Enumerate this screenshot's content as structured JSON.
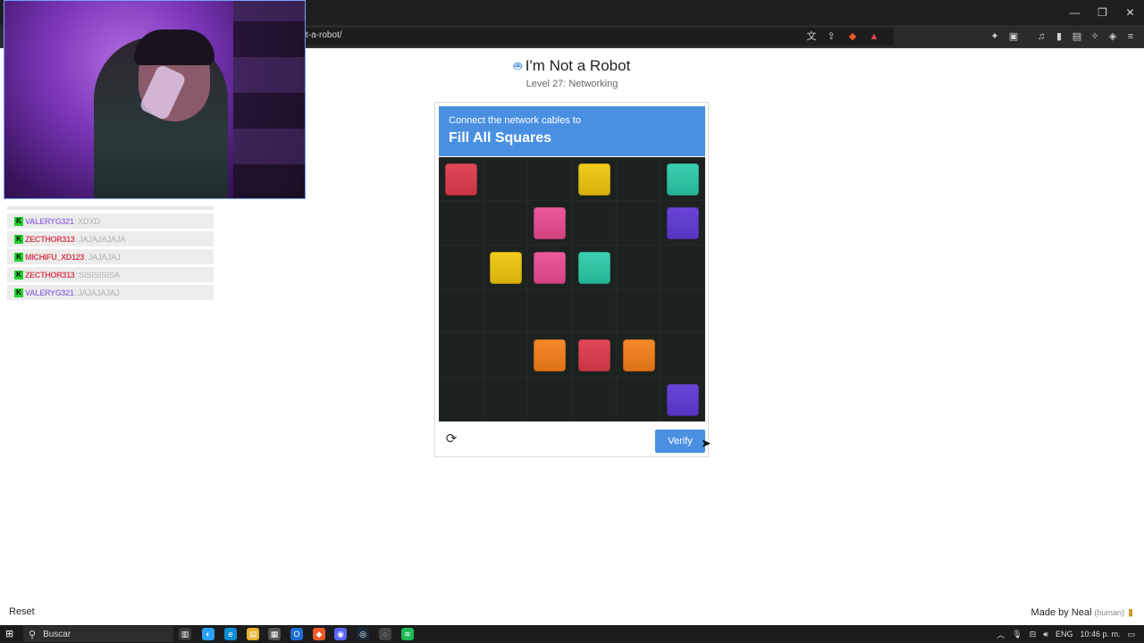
{
  "browser": {
    "url": "t-a-robot/",
    "window_controls": [
      "—",
      "❐",
      "✕"
    ],
    "icons": [
      "translate-icon",
      "share-icon",
      "brave-shield-icon",
      "rewards-icon",
      "extensions-icon",
      "screenshot-icon",
      "media-icon",
      "sidebar-icon",
      "wallet-icon",
      "leo-icon",
      "vpn-icon",
      "menu-icon"
    ]
  },
  "chat": {
    "messages": [
      {
        "user": "VALERYG321",
        "text": "XDXD",
        "color": "#9b7be0"
      },
      {
        "user": "ZECTHOR313",
        "text": "JAJAJAJAJA",
        "color": "#d9445a"
      },
      {
        "user": "MICHIFU_XD123",
        "text": "JAJAJAJ",
        "color": "#d9445a"
      },
      {
        "user": "ZECTHOR313",
        "text": "SISISISISA",
        "color": "#d9445a"
      },
      {
        "user": "VALERYG321",
        "text": "JAJAJAJAJ",
        "color": "#9b7be0"
      }
    ]
  },
  "page": {
    "title": "I'm Not a Robot",
    "subtitle": "Level 27: Networking",
    "card": {
      "instruction": "Connect the network cables to",
      "headline": "Fill All Squares",
      "verify_label": "Verify"
    },
    "grid": {
      "rows": 6,
      "cols": 6,
      "squares": [
        {
          "row": 1,
          "col": 1,
          "color": "red"
        },
        {
          "row": 1,
          "col": 4,
          "color": "yellow"
        },
        {
          "row": 1,
          "col": 6,
          "color": "teal"
        },
        {
          "row": 2,
          "col": 3,
          "color": "pink"
        },
        {
          "row": 2,
          "col": 6,
          "color": "purple"
        },
        {
          "row": 3,
          "col": 2,
          "color": "yellow"
        },
        {
          "row": 3,
          "col": 3,
          "color": "pink"
        },
        {
          "row": 3,
          "col": 4,
          "color": "teal"
        },
        {
          "row": 5,
          "col": 3,
          "color": "orange"
        },
        {
          "row": 5,
          "col": 4,
          "color": "red"
        },
        {
          "row": 5,
          "col": 5,
          "color": "orange"
        },
        {
          "row": 6,
          "col": 6,
          "color": "purple"
        }
      ]
    },
    "reset_label": "Reset",
    "made_by": "Made by Neal",
    "made_by_note": "(human)"
  },
  "taskbar": {
    "search_placeholder": "Buscar",
    "language": "ENG",
    "time": "10:46 p. m."
  },
  "colors": {
    "accent": "#4a90e2",
    "grid_bg": "#1c2220"
  }
}
